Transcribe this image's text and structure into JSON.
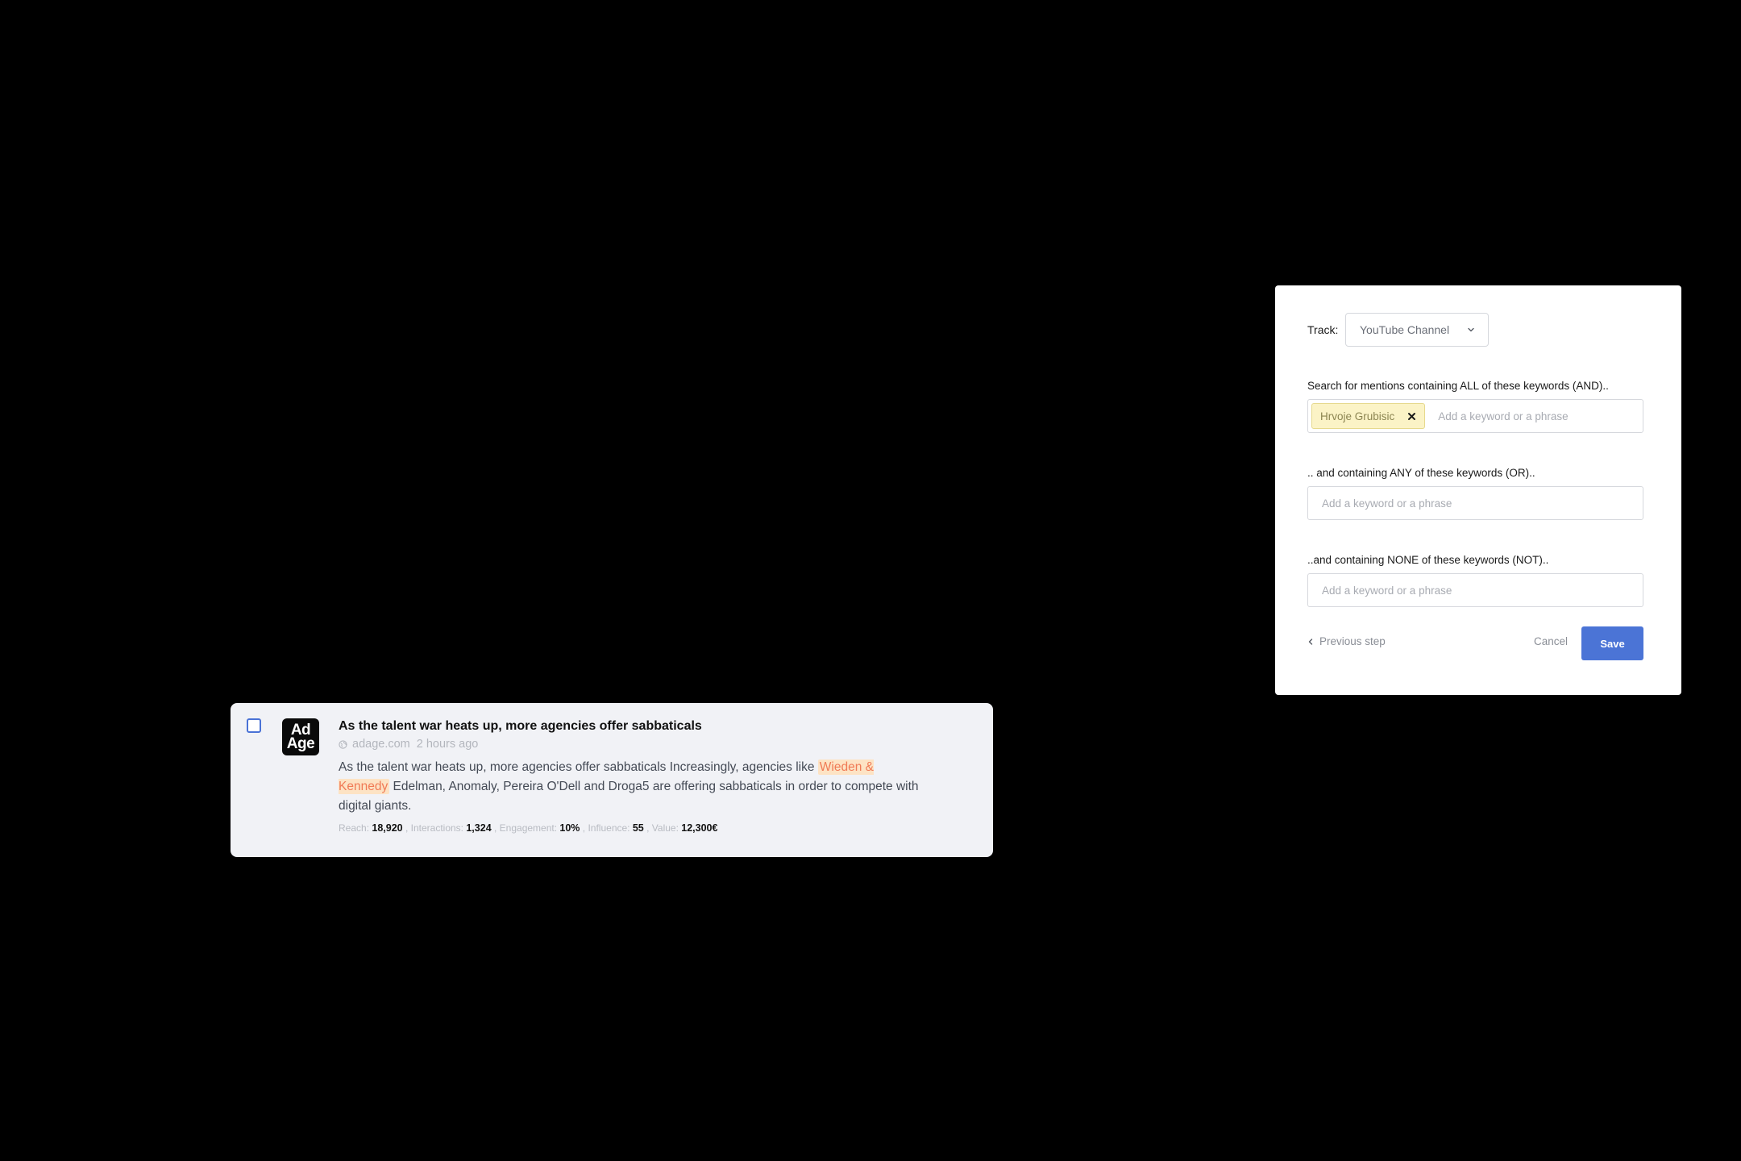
{
  "mention": {
    "logo_line1": "Ad",
    "logo_line2": "Age",
    "title": "As the talent war heats up, more agencies offer sabbaticals",
    "source_domain": "adage.com",
    "time_ago": "2 hours ago",
    "body_before": "As the talent war heats up, more agencies offer sabbaticals Increasingly, agencies like ",
    "body_highlight": "Wieden & Kennedy",
    "body_after": " Edelman, Anomaly, Pereira O'Dell and Droga5 are offering sabbaticals in order to compete with digital giants.",
    "stats": {
      "reach_label": "Reach:",
      "reach_value": "18,920",
      "interactions_label": "Interactions:",
      "interactions_value": "1,324",
      "engagement_label": "Engagement:",
      "engagement_value": "10%",
      "influence_label": "Influence:",
      "influence_value": "55",
      "value_label": "Value:",
      "value_value": "12,300€",
      "separator": ","
    },
    "icons": {
      "checkbox": "checkbox-icon",
      "source": "globe-icon"
    }
  },
  "tracker": {
    "track_label": "Track:",
    "track_selected": "YouTube Channel",
    "and_label": "Search for mentions containing ALL of these keywords (AND)..",
    "and_keywords": [
      "Hrvoje Grubisic"
    ],
    "or_label": ".. and containing ANY of these keywords (OR)..",
    "not_label": "..and containing NONE of these keywords (NOT)..",
    "input_placeholder": "Add a keyword or a phrase",
    "previous_label": "Previous step",
    "cancel_label": "Cancel",
    "save_label": "Save"
  },
  "colors": {
    "accent": "#4b74d6",
    "highlight_bg": "#fde3c4",
    "highlight_text": "#f07a55",
    "chip_bg": "#fbf3c6"
  }
}
